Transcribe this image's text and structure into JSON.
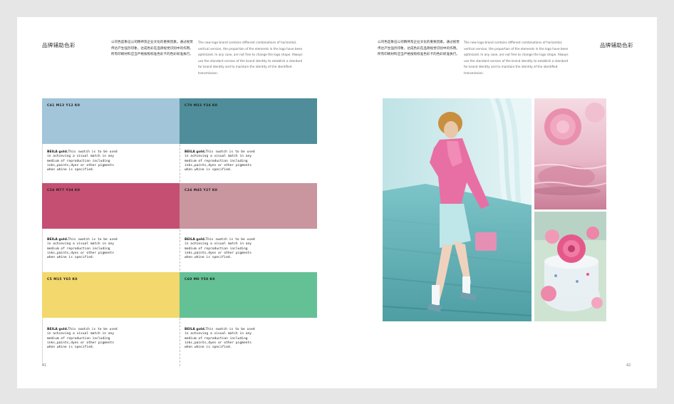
{
  "left_page": {
    "title": "品牌辅助色彩",
    "cn_text": "公司色是象征公司精神及企业文化的重要因素。通过视觉传达产生强烈印象，达成色彩在品牌视觉识别中的作用。所有印刷材料应当严格按照标准色彩卡的色彩标准执行。",
    "en_text": "The new logo brand contains different combinations of horizontal, vertical version, the proportion of the elements in the logo have been optimized. In any case, are not free to change the logo shape. Always use the standard version of the brand identity to establish a standard for brand identity and to maintain the identity of the identified transmission.",
    "page_number": "41",
    "swatches": [
      {
        "cmyk": "C41  M13  Y12  K0",
        "color": "#a2c5d9"
      },
      {
        "cmyk": "C70  M33  Y34  K0",
        "color": "#4f8d9a"
      },
      {
        "cmyk": "C24  M77  Y34  K0",
        "color": "#c44f72"
      },
      {
        "cmyk": "C24  M45  Y27  K0",
        "color": "#c9959f"
      },
      {
        "cmyk": "C5  M15  Y65  K0",
        "color": "#f2d86d"
      },
      {
        "cmyk": "C60  M0  Y50  K0",
        "color": "#64c196"
      }
    ],
    "desc_bold": "BEILA gold.",
    "desc_text": "This swatch is to be used in achieving a visual match in any medium of reproduction including inks,paints,dyes or other pigments when whine is specified."
  },
  "right_page": {
    "title": "品牌辅助色彩",
    "cn_text": "公司色是象征公司精神及企业文化的重要因素。通过视觉传达产生强烈印象，达成色彩在品牌视觉识别中的作用。所有印刷材料应当严格按照标准色彩卡的色彩标准执行。",
    "en_text": "The new logo brand contains different combinations of horizontal, vertical version, the proportion of the elements in the logo have been optimized. In any case, are not free to change the logo shape. Always use the standard version of the brand identity to establish a standard for brand identity and to maintain the identity of the identified transmission.",
    "page_number": "42"
  }
}
